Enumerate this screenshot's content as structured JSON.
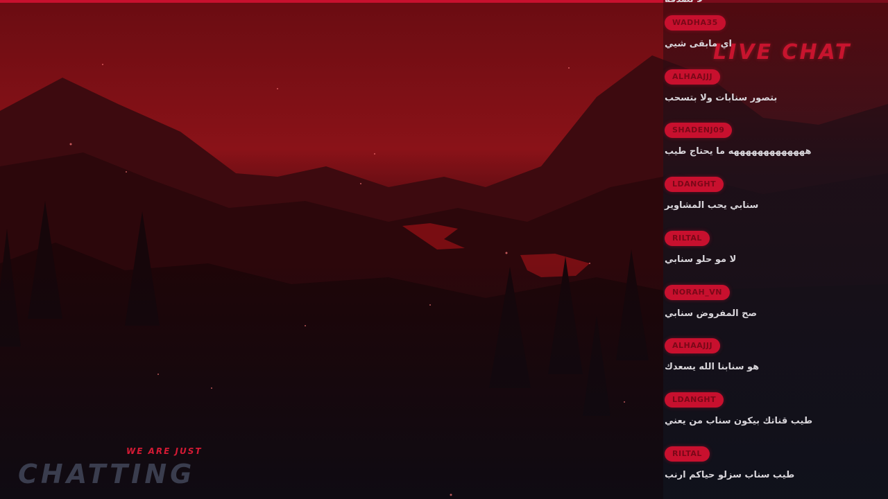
{
  "overlay": {
    "live_title": "LIVE CHAT",
    "bottom_tagline": "WE ARE JUST",
    "bottom_title": "CHATTING",
    "accent_color": "#c8102e"
  },
  "chat": {
    "partial_top_text": "لا تصدقه يزيد",
    "messages": [
      {
        "user": "WADHA35",
        "text": "اي مابقى شيي"
      },
      {
        "user": "ALHAAJJJ",
        "text": "بتصور سنابات ولا بتسحب"
      },
      {
        "user": "SHADENJ09",
        "text": "هههههههههههههه ما يحتاج طيب"
      },
      {
        "user": "LDANGHT",
        "text": "سنابي يحب المشاوير"
      },
      {
        "user": "RILTAL",
        "text": "لا مو حلو سنابي"
      },
      {
        "user": "NORAH_VN",
        "text": "صح المفروض سنابي"
      },
      {
        "user": "ALHAAJJJ",
        "text": "هو سنابنا الله يسعدك"
      },
      {
        "user": "LDANGHT",
        "text": "طيب قناتك بيكون سناب من يعني"
      },
      {
        "user": "RILTAL",
        "text": "طيب سناب سزلو حياكم ارنب"
      }
    ]
  }
}
